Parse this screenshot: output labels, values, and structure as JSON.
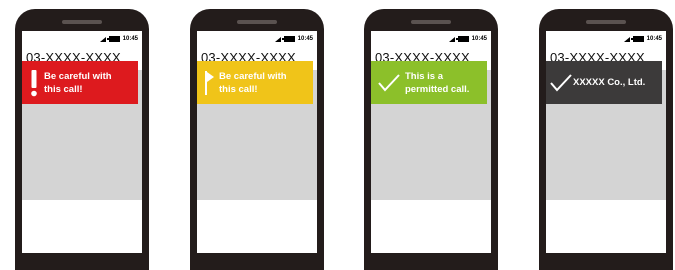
{
  "phones": [
    {
      "time": "10:45",
      "number": "03-XXXX-XXXX",
      "banner": {
        "lines": [
          "Be careful with",
          "this call!"
        ],
        "icon": "exclamation-icon",
        "color": "#dd1a1e"
      }
    },
    {
      "time": "10:45",
      "number": "03-XXXX-XXXX",
      "banner": {
        "lines": [
          "Be careful with",
          "this call!"
        ],
        "icon": "flag-icon",
        "color": "#f0c419"
      }
    },
    {
      "time": "10:45",
      "number": "03-XXXX-XXXX",
      "banner": {
        "lines": [
          "This is a",
          "permitted call."
        ],
        "icon": "checkmark-icon",
        "color": "#8cc02a"
      }
    },
    {
      "time": "10:45",
      "number": "03-XXXX-XXXX",
      "banner": {
        "lines": [
          "XXXXX Co., Ltd."
        ],
        "icon": "checkmark-icon",
        "color": "#3c3a3a"
      }
    }
  ]
}
